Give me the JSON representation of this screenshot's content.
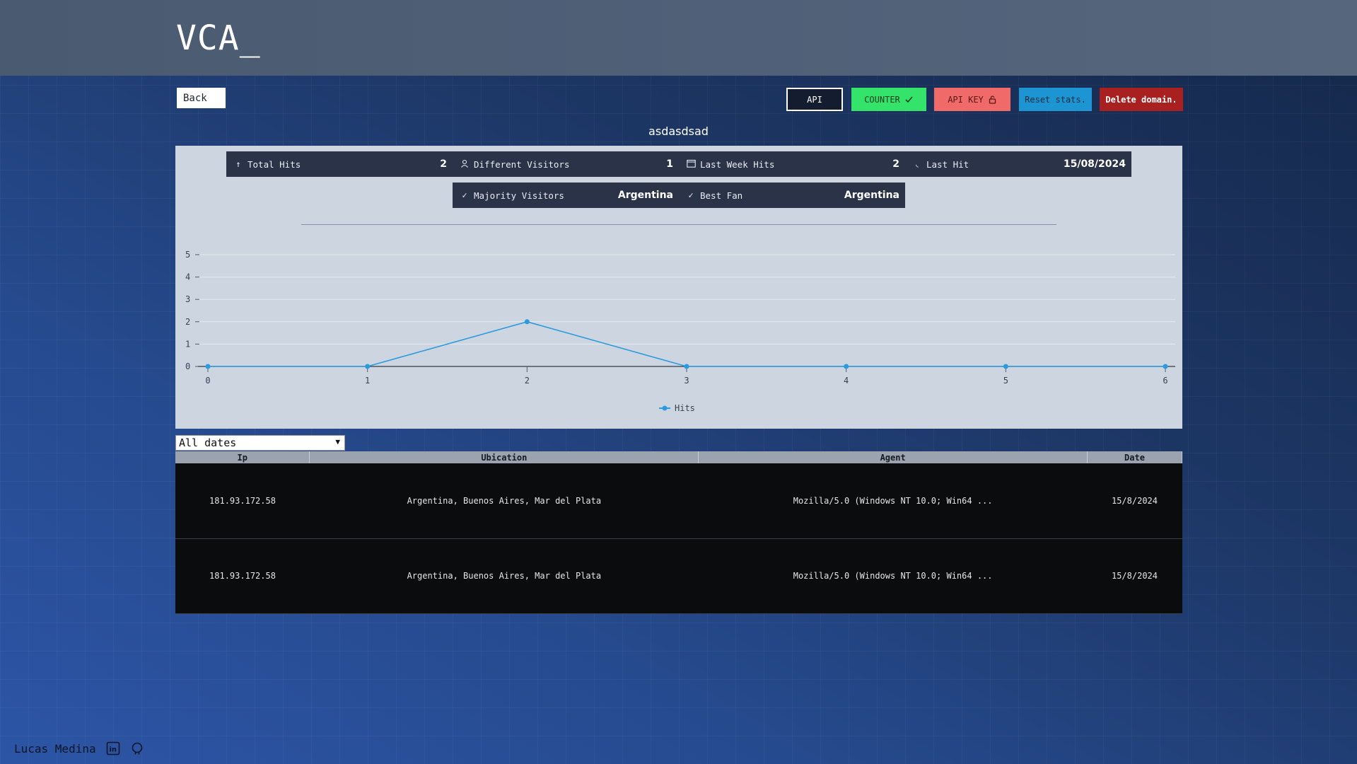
{
  "header": {
    "logo": "VCA_"
  },
  "nav": {
    "back_label": "Back"
  },
  "actions": {
    "api_label": "API",
    "counter_label": "COUNTER",
    "apikey_label": "API KEY",
    "reset_label": "Reset stats.",
    "delete_label": "Delete domain."
  },
  "domain": {
    "name": "asdasdsad"
  },
  "stats": {
    "total_hits": {
      "label": "Total Hits",
      "value": "2",
      "icon": "arrow-up-icon"
    },
    "different_visitors": {
      "label": "Different Visitors",
      "value": "1",
      "icon": "user-icon"
    },
    "last_week_hits": {
      "label": "Last Week Hits",
      "value": "2",
      "icon": "calendar-icon"
    },
    "last_hit": {
      "label": "Last Hit",
      "value": "15/08/2024",
      "icon": "clock-icon"
    },
    "majority_visitors": {
      "label": "Majority Visitors",
      "value": "Argentina",
      "icon": "check-icon"
    },
    "best_fan": {
      "label": "Best Fan",
      "value": "Argentina",
      "icon": "check-icon"
    }
  },
  "chart_data": {
    "type": "line",
    "x": [
      0,
      1,
      2,
      3,
      4,
      5,
      6
    ],
    "series": [
      {
        "name": "Hits",
        "values": [
          0,
          0,
          2,
          0,
          0,
          0,
          0
        ],
        "color": "#2b9be0"
      }
    ],
    "xlabel": "",
    "ylabel": "",
    "ylim": [
      0,
      5
    ],
    "yticks": [
      0,
      1,
      2,
      3,
      4,
      5
    ],
    "grid": true,
    "legend": "bottom-center"
  },
  "filter": {
    "selected": "All dates"
  },
  "table": {
    "headers": [
      "Ip",
      "Ubication",
      "Agent",
      "Date"
    ],
    "rows": [
      [
        "181.93.172.58",
        "Argentina, Buenos Aires, Mar del Plata",
        "Mozilla/5.0 (Windows NT 10.0; Win64 ...",
        "15/8/2024"
      ],
      [
        "181.93.172.58",
        "Argentina, Buenos Aires, Mar del Plata",
        "Mozilla/5.0 (Windows NT 10.0; Win64 ...",
        "15/8/2024"
      ]
    ]
  },
  "footer": {
    "author": "Lucas Medina"
  },
  "colors": {
    "counter": "#33e36a",
    "apikey": "#f06a6a",
    "reset": "#1c95d2",
    "delete": "#a82020",
    "line": "#2b9be0"
  }
}
